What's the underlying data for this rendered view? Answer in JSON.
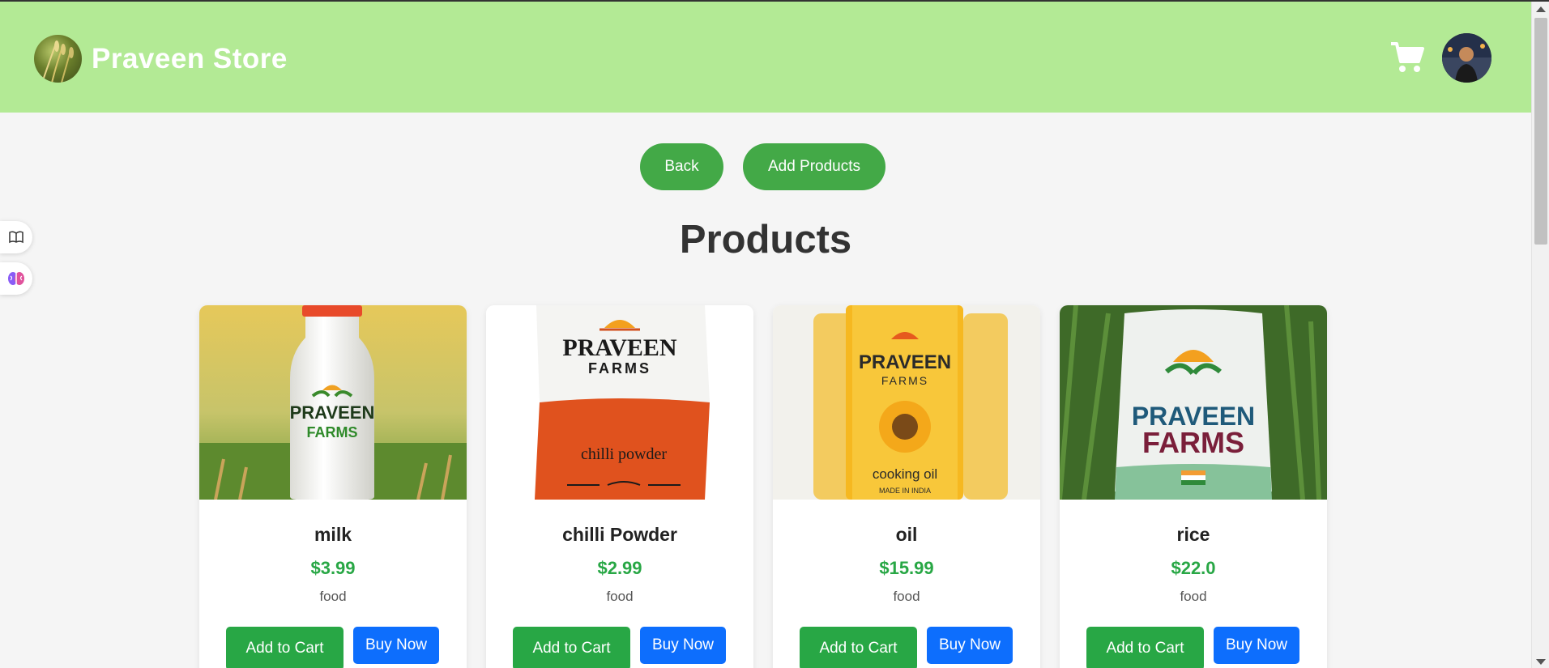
{
  "header": {
    "brand_name": "Praveen Store",
    "logo_icon": "wheat-field-logo",
    "cart_icon": "shopping-cart-icon",
    "avatar_icon": "user-avatar"
  },
  "actions": {
    "back_label": "Back",
    "add_products_label": "Add Products"
  },
  "page": {
    "title": "Products"
  },
  "side_tools": [
    "book-icon",
    "brain-icon"
  ],
  "products": [
    {
      "name": "milk",
      "price": "$3.99",
      "category": "food",
      "image": "milk-bottle",
      "add_label": "Add to Cart",
      "buy_label": "Buy Now"
    },
    {
      "name": "chilli Powder",
      "price": "$2.99",
      "category": "food",
      "image": "chilli-powder-pack",
      "add_label": "Add to Cart",
      "buy_label": "Buy Now"
    },
    {
      "name": "oil",
      "price": "$15.99",
      "category": "food",
      "image": "cooking-oil-jars",
      "add_label": "Add to Cart",
      "buy_label": "Buy Now"
    },
    {
      "name": "rice",
      "price": "$22.0",
      "category": "food",
      "image": "rice-bag",
      "add_label": "Add to Cart",
      "buy_label": "Buy Now"
    }
  ],
  "image_text": {
    "brand_line1": "PRAVEEN",
    "brand_line2": "FARMS",
    "chilli_label": "chilli powder",
    "oil_label": "cooking oil",
    "oil_sub": "MADE IN INDIA"
  },
  "colors": {
    "header_bg": "#b3ea95",
    "pill_green": "#43a947",
    "cart_green": "#28a745",
    "buy_blue": "#0d6efd",
    "price_green": "#28a745"
  }
}
